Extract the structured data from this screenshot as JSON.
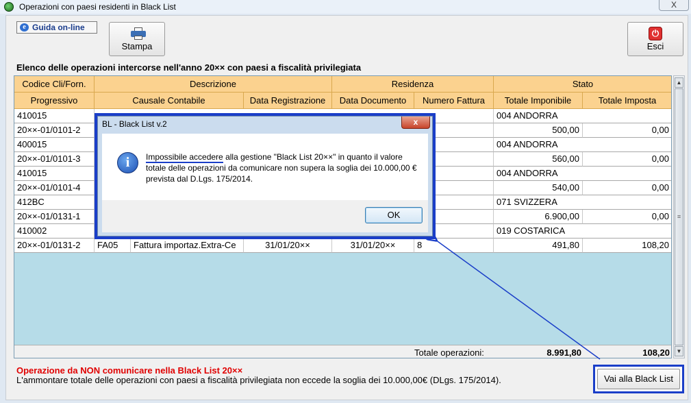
{
  "window": {
    "title": "Operazioni con paesi residenti in Black List",
    "close_glyph": "X"
  },
  "toolbar": {
    "guida_label": "Guida on-line",
    "stampa_label": "Stampa",
    "esci_label": "Esci"
  },
  "section_title": "Elenco delle operazioni intercorse nell'anno 20×× con paesi a fiscalità privilegiata",
  "table": {
    "header_row1": [
      "Codice Cli/Forn.",
      "Descrizione",
      "Residenza",
      "Stato"
    ],
    "header_row2": [
      "Progressivo",
      "Causale Contabile",
      "Data Registrazione",
      "Data Documento",
      "Numero Fattura",
      "Totale Imponibile",
      "Totale Imposta"
    ],
    "records": [
      {
        "codice": "410015",
        "stato": "004 ANDORRA",
        "progressivo": "20××-01/0101-2",
        "causale": "",
        "descrizione": "",
        "data_reg": "",
        "data_doc": "",
        "numero": "",
        "imponibile": "500,00",
        "imposta": "0,00"
      },
      {
        "codice": "400015",
        "stato": "004 ANDORRA",
        "progressivo": "20××-01/0101-3",
        "causale": "",
        "descrizione": "",
        "data_reg": "",
        "data_doc": "",
        "numero": "",
        "imponibile": "560,00",
        "imposta": "0,00"
      },
      {
        "codice": "410015",
        "stato": "004 ANDORRA",
        "progressivo": "20××-01/0101-4",
        "causale": "",
        "descrizione": "",
        "data_reg": "",
        "data_doc": "",
        "numero": "",
        "imponibile": "540,00",
        "imposta": "0,00"
      },
      {
        "codice": "412BC",
        "stato": "071 SVIZZERA",
        "progressivo": "20××-01/0131-1",
        "causale": "",
        "descrizione": "",
        "data_reg": "",
        "data_doc": "",
        "numero": "",
        "imponibile": "6.900,00",
        "imposta": "0,00"
      },
      {
        "codice": "410002",
        "stato": "019 COSTARICA",
        "progressivo": "20××-01/0131-2",
        "causale": "FA05",
        "descrizione": "Fattura importaz.Extra-Ce",
        "data_reg": "31/01/20××",
        "data_doc": "31/01/20××",
        "numero": "8",
        "imponibile": "491,80",
        "imposta": "108,20"
      }
    ],
    "total_label": "Totale operazioni:",
    "total_imponibile": "8.991,80",
    "total_imposta": "108,20"
  },
  "warning": {
    "title": "Operazione da NON comunicare nella Black List 20××",
    "text": "L'ammontare totale delle operazioni con paesi a fiscalità privilegiata non eccede la soglia dei 10.000,00€ (DLgs. 175/2014)."
  },
  "vai_button": "Vai alla Black List",
  "dialog": {
    "title": "BL - Black List v.2",
    "close_glyph": "x",
    "message_prefix": "Impossibile accedere",
    "message_rest": " alla gestione \"Black List 20××\" in quanto il valore totale delle operazioni da comunicare non supera la soglia dei 10.000,00 € prevista dal D.Lgs. 175/2014.",
    "ok_label": "OK"
  },
  "icons": {
    "app": "globe-icon",
    "printer": "printer-icon",
    "exit": "power-icon",
    "info": "info-icon",
    "help": "ie-icon"
  },
  "colors": {
    "header": "#fbd28f",
    "grid_bg": "#b6dce8",
    "warning": "#e00000",
    "highlight": "#1a3ec8"
  }
}
